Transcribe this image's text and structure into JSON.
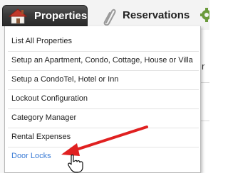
{
  "nav": {
    "properties_label": "Properties",
    "reservations_label": "Reservations",
    "properties_icon": "house-icon",
    "reservations_icon": "paperclip-icon",
    "next_tab_icon": "settings-icon"
  },
  "menu": {
    "items": [
      {
        "label": "List All Properties"
      },
      {
        "label": "Setup an Apartment, Condo, Cottage, House or Villa"
      },
      {
        "label": "Setup a CondoTel, Hotel or Inn"
      },
      {
        "label": "Lockout Configuration"
      },
      {
        "label": "Category Manager"
      },
      {
        "label": "Rental Expenses"
      },
      {
        "label": "Door Locks"
      }
    ],
    "highlighted_item": "Door Locks"
  },
  "background": {
    "partial_char": "r"
  },
  "colors": {
    "nav_active_bg": "#2b2b2b",
    "link_blue": "#3a7bd5",
    "annotation_arrow": "#e02020"
  }
}
